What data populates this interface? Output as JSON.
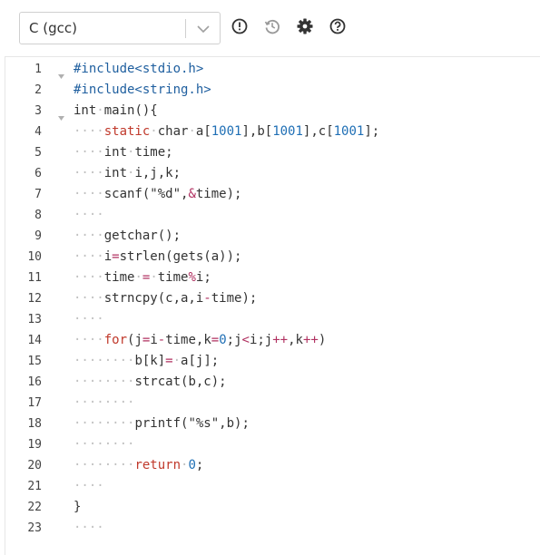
{
  "toolbar": {
    "language": "C (gcc)",
    "icons": [
      "info-icon",
      "history-icon",
      "gear-icon",
      "help-icon"
    ]
  },
  "editor": {
    "lines": [
      {
        "n": "1",
        "fold": true,
        "tokens": [
          [
            "pp",
            "#include<stdio.h>"
          ]
        ]
      },
      {
        "n": "2",
        "fold": false,
        "tokens": [
          [
            "pp",
            "#include<string.h>"
          ]
        ]
      },
      {
        "n": "3",
        "fold": true,
        "tokens": [
          [
            "",
            "int"
          ],
          [
            "ws",
            "·"
          ],
          [
            "",
            "main(){"
          ]
        ]
      },
      {
        "n": "4",
        "fold": false,
        "tokens": [
          [
            "ws",
            "····"
          ],
          [
            "kw",
            "static"
          ],
          [
            "ws",
            "·"
          ],
          [
            "",
            "char"
          ],
          [
            "ws",
            "·"
          ],
          [
            "",
            "a["
          ],
          [
            "num",
            "1001"
          ],
          [
            "",
            "],b["
          ],
          [
            "num",
            "1001"
          ],
          [
            "",
            "],c["
          ],
          [
            "num",
            "1001"
          ],
          [
            "",
            "];"
          ]
        ]
      },
      {
        "n": "5",
        "fold": false,
        "tokens": [
          [
            "ws",
            "····"
          ],
          [
            "",
            "int"
          ],
          [
            "ws",
            "·"
          ],
          [
            "",
            "time;"
          ]
        ]
      },
      {
        "n": "6",
        "fold": false,
        "tokens": [
          [
            "ws",
            "····"
          ],
          [
            "",
            "int"
          ],
          [
            "ws",
            "·"
          ],
          [
            "",
            "i,j,k;"
          ]
        ]
      },
      {
        "n": "7",
        "fold": false,
        "tokens": [
          [
            "ws",
            "····"
          ],
          [
            "",
            "scanf(\"%d\","
          ],
          [
            "op",
            "&"
          ],
          [
            "",
            "time);"
          ]
        ]
      },
      {
        "n": "8",
        "fold": false,
        "tokens": [
          [
            "ws",
            "····"
          ]
        ]
      },
      {
        "n": "9",
        "fold": false,
        "tokens": [
          [
            "ws",
            "····"
          ],
          [
            "",
            "getchar();"
          ]
        ]
      },
      {
        "n": "10",
        "fold": false,
        "tokens": [
          [
            "ws",
            "····"
          ],
          [
            "",
            "i"
          ],
          [
            "op",
            "="
          ],
          [
            "",
            "strlen(gets(a));"
          ]
        ]
      },
      {
        "n": "11",
        "fold": false,
        "tokens": [
          [
            "ws",
            "····"
          ],
          [
            "",
            "time"
          ],
          [
            "ws",
            "·"
          ],
          [
            "op",
            "="
          ],
          [
            "ws",
            "·"
          ],
          [
            "",
            "time"
          ],
          [
            "op",
            "%"
          ],
          [
            "",
            "i;"
          ]
        ]
      },
      {
        "n": "12",
        "fold": false,
        "tokens": [
          [
            "ws",
            "····"
          ],
          [
            "",
            "strncpy(c,a,i"
          ],
          [
            "op",
            "-"
          ],
          [
            "",
            "time);"
          ]
        ]
      },
      {
        "n": "13",
        "fold": false,
        "tokens": [
          [
            "ws",
            "····"
          ]
        ]
      },
      {
        "n": "14",
        "fold": false,
        "tokens": [
          [
            "ws",
            "····"
          ],
          [
            "kw",
            "for"
          ],
          [
            "",
            "(j"
          ],
          [
            "op",
            "="
          ],
          [
            "",
            "i"
          ],
          [
            "op",
            "-"
          ],
          [
            "",
            "time,k"
          ],
          [
            "op",
            "="
          ],
          [
            "num",
            "0"
          ],
          [
            "",
            ";j"
          ],
          [
            "op",
            "<"
          ],
          [
            "",
            "i;j"
          ],
          [
            "op",
            "++"
          ],
          [
            "",
            ",k"
          ],
          [
            "op",
            "++"
          ],
          [
            "",
            ")"
          ]
        ]
      },
      {
        "n": "15",
        "fold": false,
        "tokens": [
          [
            "ws",
            "········"
          ],
          [
            "",
            "b[k]"
          ],
          [
            "op",
            "="
          ],
          [
            "ws",
            "·"
          ],
          [
            "",
            "a[j];"
          ]
        ]
      },
      {
        "n": "16",
        "fold": false,
        "tokens": [
          [
            "ws",
            "········"
          ],
          [
            "",
            "strcat(b,c);"
          ]
        ]
      },
      {
        "n": "17",
        "fold": false,
        "tokens": [
          [
            "ws",
            "········"
          ]
        ]
      },
      {
        "n": "18",
        "fold": false,
        "tokens": [
          [
            "ws",
            "········"
          ],
          [
            "",
            "printf(\"%s\",b);"
          ]
        ]
      },
      {
        "n": "19",
        "fold": false,
        "tokens": [
          [
            "ws",
            "········"
          ]
        ]
      },
      {
        "n": "20",
        "fold": false,
        "tokens": [
          [
            "ws",
            "········"
          ],
          [
            "kw",
            "return"
          ],
          [
            "ws",
            "·"
          ],
          [
            "num",
            "0"
          ],
          [
            "",
            ";"
          ]
        ]
      },
      {
        "n": "21",
        "fold": false,
        "tokens": [
          [
            "ws",
            "····"
          ]
        ]
      },
      {
        "n": "22",
        "fold": false,
        "tokens": [
          [
            "",
            "}"
          ]
        ]
      },
      {
        "n": "23",
        "fold": false,
        "tokens": [
          [
            "ws",
            "····"
          ]
        ]
      }
    ]
  }
}
